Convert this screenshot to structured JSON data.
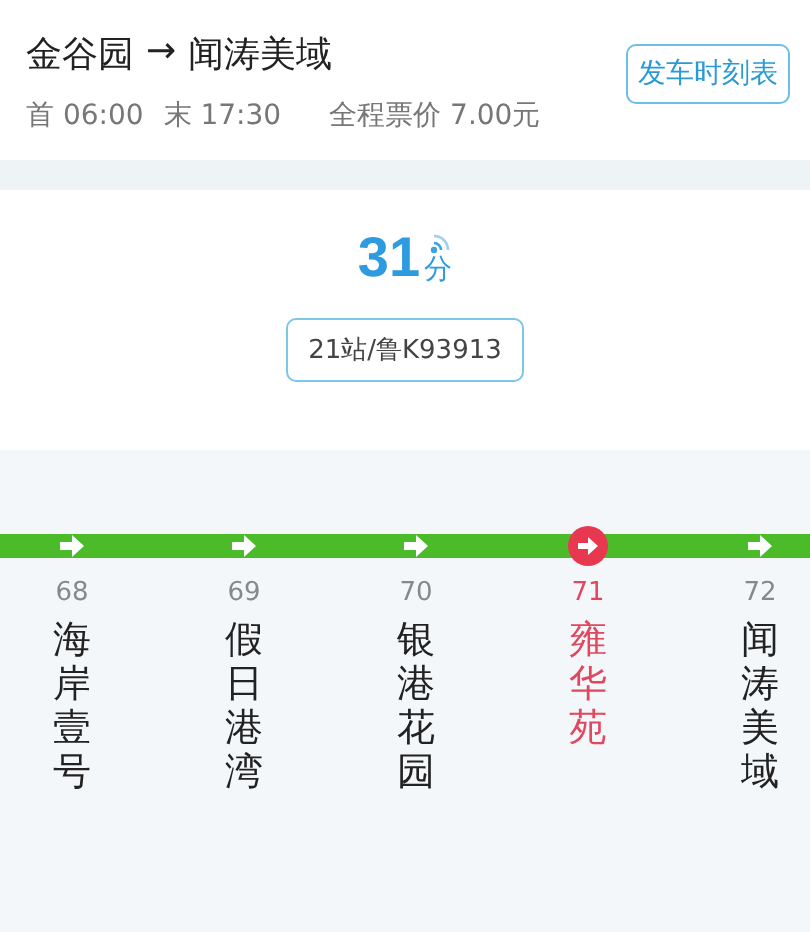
{
  "route": {
    "from": "金谷园",
    "arrow": "→",
    "to": "闻涛美域"
  },
  "first_bus": "首 06:00",
  "last_bus": "末 17:30",
  "fare": "全程票价 7.00元",
  "timetable_button": "发车时刻表",
  "eta": {
    "value": "31",
    "unit": "分"
  },
  "bus_info": "21站/鲁K93913",
  "stations": [
    {
      "number": "68",
      "name": "海岸壹号",
      "selected": false
    },
    {
      "number": "69",
      "name": "假日港湾",
      "selected": false
    },
    {
      "number": "70",
      "name": "银港花园",
      "selected": false
    },
    {
      "number": "71",
      "name": "雍华苑",
      "selected": true
    },
    {
      "number": "72",
      "name": "闻涛美域",
      "selected": false
    }
  ]
}
